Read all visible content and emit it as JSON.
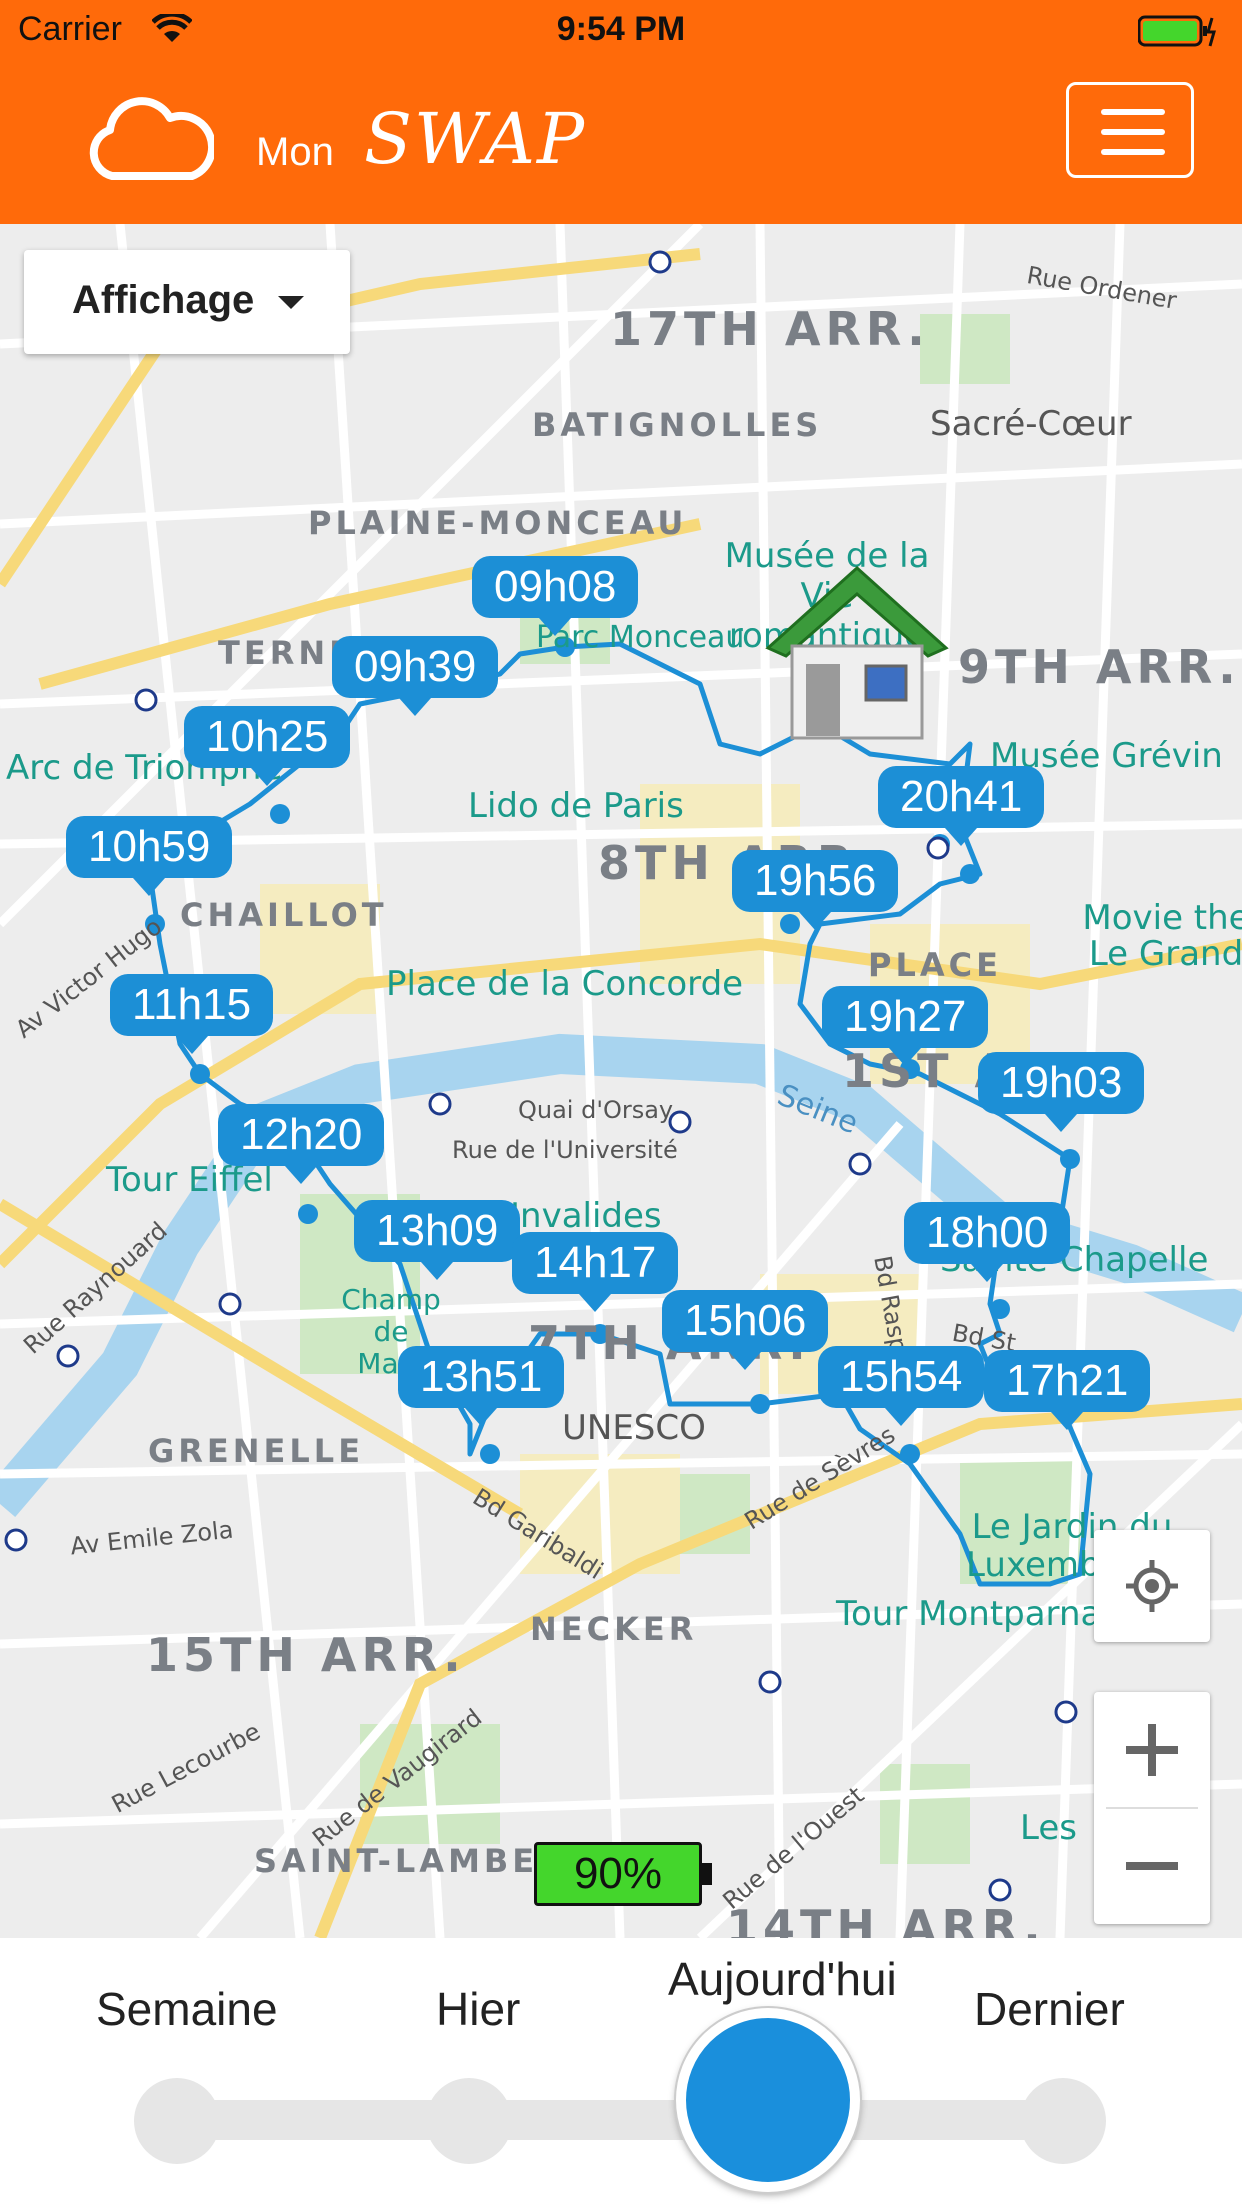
{
  "status_bar": {
    "carrier": "Carrier",
    "time": "9:54 PM"
  },
  "header": {
    "mon_label": "Mon",
    "brand": "SWAP",
    "icon": "cloud-icon"
  },
  "map": {
    "display_dropdown": "Affichage",
    "districts": [
      "17TH ARR.",
      "9TH ARR.",
      "8TH ARR.",
      "1ST ARR.",
      "7TH ARR.",
      "15TH ARR.",
      "14TH ARR."
    ],
    "quarters": [
      "BATIGNOLLES",
      "PLAINE-MONCEAU",
      "TERNES",
      "CHAILLOT",
      "PLACE",
      "GRENELLE",
      "NECKER",
      "SAINT-LAMBERT"
    ],
    "places": [
      "Sacré-Cœur",
      "Musée de la Vie romantique",
      "Musée Grévin",
      "Lido de Paris",
      "Arc de Triomphe",
      "Place de la Concorde",
      "Movie the Le Grand",
      "Tour Eiffel",
      "Invalides",
      "Champ de Mars",
      "UNESCO",
      "Sainte-Chapelle",
      "Le Jardin du Luxembourg",
      "Tour Montparnasse",
      "Parc Monceau",
      "Les"
    ],
    "streets": [
      "Rue Ordener",
      "Av Victor Hugo",
      "Quai d'Orsay",
      "Rue de l'Université",
      "Seine",
      "Rue Raynouard",
      "Av Emile Zola",
      "Bd Garibaldi",
      "Rue de Sèvres",
      "Rue Lecourbe",
      "Rue de Vaugirard",
      "Bd Raspail",
      "Bd St",
      "Rue de l'Ouest"
    ],
    "time_markers": [
      "09h08",
      "09h39",
      "10h25",
      "10h59",
      "11h15",
      "12h20",
      "13h09",
      "13h51",
      "14h17",
      "15h06",
      "15h54",
      "17h21",
      "18h00",
      "19h03",
      "19h27",
      "19h56",
      "20h41"
    ],
    "battery_badge": "90%",
    "home_icon": "home-icon"
  },
  "bottom_nav": {
    "items": [
      "Semaine",
      "Hier",
      "Aujourd'hui",
      "Dernier"
    ],
    "selected": "Aujourd'hui"
  },
  "colors": {
    "header": "#ff6a0a",
    "route": "#1c8fd6",
    "battery": "#44d62c"
  }
}
